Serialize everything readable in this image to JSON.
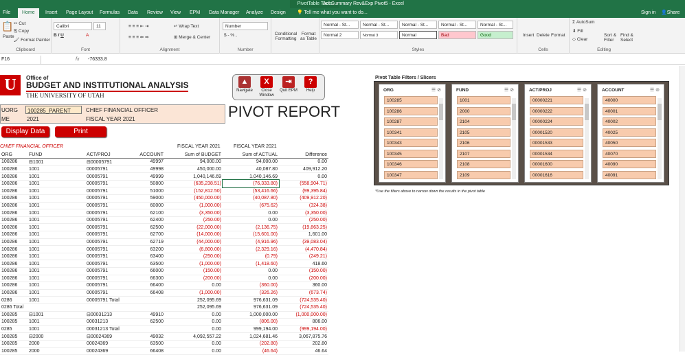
{
  "titlebar": {
    "context_tab": "PivotTable Tools",
    "title": "Act Summary Rev&Exp Pivot5 - Excel"
  },
  "tabs": [
    "File",
    "Home",
    "Insert",
    "Page Layout",
    "Formulas",
    "Data",
    "Review",
    "View",
    "EPM",
    "Data Manager",
    "Analyze",
    "Design"
  ],
  "tell_me": "Tell me what you want to do...",
  "signin": "Sign in",
  "share": "Share",
  "ribbon": {
    "cut": "Cut",
    "copy": "Copy",
    "format_painter": "Format Painter",
    "paste": "Paste",
    "clipboard": "Clipboard",
    "font_name": "Calibri",
    "font_size": "11",
    "font": "Font",
    "wrap": "Wrap Text",
    "merge": "Merge & Center",
    "alignment": "Alignment",
    "numfmt": "Number",
    "number": "Number",
    "cond": "Conditional Formatting",
    "fmt_table": "Format as Table",
    "styles": [
      "Normal - St...",
      "Normal - St...",
      "Normal - St...",
      "Normal - St...",
      "Normal - St...",
      "Normal 2",
      "Normal 3",
      "Normal",
      "Bad",
      "Good"
    ],
    "styles_label": "Styles",
    "insert": "Insert",
    "delete": "Delete",
    "format": "Format",
    "cells": "Cells",
    "autosum": "AutoSum",
    "fill": "Fill",
    "clear": "Clear",
    "sort": "Sort & Filter",
    "find": "Find & Select",
    "editing": "Editing"
  },
  "formula": {
    "name": "F16",
    "fx": "fx",
    "value": "-76333.8"
  },
  "header": {
    "office": "Office of",
    "budget": "BUDGET AND INSTITUTIONAL ANALYSIS",
    "uu": "THE UNIVERSITY OF UTAH",
    "logo": "U",
    "org_label": "UORG",
    "org_value": "100285_PARENT",
    "cfo": "CHIEF FINANCIAL OFFICER",
    "me_label": "ME",
    "year": "2021",
    "fy": "FISCAL YEAR 2021",
    "pivot_title": "PIVOT REPORT",
    "display": "Display Data",
    "print": "Print"
  },
  "nav": [
    {
      "label": "Navigate",
      "g": "▲"
    },
    {
      "label": "Close Window",
      "g": "X"
    },
    {
      "label": "Quit EPM",
      "g": "⇥"
    },
    {
      "label": "Help",
      "g": "?"
    }
  ],
  "pivot": {
    "cfo": "CHIEF FINANCIAL OFFICER",
    "fy1": "FISCAL YEAR 2021",
    "fy2": "FISCAL YEAR 2021",
    "cols": [
      "ORG",
      "FUND",
      "ACT/PROJ",
      "ACCOUNT",
      "Sum of BUDGET",
      "Sum of ACTUAL",
      "Difference"
    ],
    "rows": [
      [
        "100286",
        "⊟1001",
        "⊟00005791",
        "49997",
        "94,000.00",
        "94,000.00",
        "0.00"
      ],
      [
        "100286",
        "1001",
        "00005791",
        "49998",
        "450,000.00",
        "40,087.80",
        "409,912.20"
      ],
      [
        "100286",
        "1001",
        "00005791",
        "49999",
        "1,040,146.69",
        "1,040,146.69",
        "0.00"
      ],
      [
        "100286",
        "1001",
        "00005791",
        "50800",
        "(635,238.51)",
        "(76,333.80)",
        "(558,904.71)"
      ],
      [
        "100286",
        "1001",
        "00005791",
        "51000",
        "(152,812.50)",
        "(53,416.66)",
        "(99,395.84)"
      ],
      [
        "100286",
        "1001",
        "00005791",
        "59000",
        "(450,000.00)",
        "(40,087.80)",
        "(409,912.20)"
      ],
      [
        "100286",
        "1001",
        "00005791",
        "60000",
        "(1,000.00)",
        "(675.62)",
        "(324.38)"
      ],
      [
        "100286",
        "1001",
        "00005791",
        "62100",
        "(3,350.00)",
        "0.00",
        "(3,350.00)"
      ],
      [
        "100286",
        "1001",
        "00005791",
        "62400",
        "(250.00)",
        "0.00",
        "(250.00)"
      ],
      [
        "100286",
        "1001",
        "00005791",
        "62500",
        "(22,000.00)",
        "(2,136.75)",
        "(19,863.25)"
      ],
      [
        "100286",
        "1001",
        "00005791",
        "62700",
        "(14,000.00)",
        "(15,601.00)",
        "1,601.00"
      ],
      [
        "100286",
        "1001",
        "00005791",
        "62719",
        "(44,000.00)",
        "(4,916.96)",
        "(39,083.04)"
      ],
      [
        "100286",
        "1001",
        "00005791",
        "63200",
        "(6,800.00)",
        "(2,329.16)",
        "(4,470.84)"
      ],
      [
        "100286",
        "1001",
        "00005791",
        "63400",
        "(250.00)",
        "(0.79)",
        "(249.21)"
      ],
      [
        "100286",
        "1001",
        "00005791",
        "63500",
        "(1,000.00)",
        "(1,418.60)",
        "418.60"
      ],
      [
        "100286",
        "1001",
        "00005791",
        "66000",
        "(150.00)",
        "0.00",
        "(150.00)"
      ],
      [
        "100286",
        "1001",
        "00005791",
        "66300",
        "(200.00)",
        "0.00",
        "(200.00)"
      ],
      [
        "100286",
        "1001",
        "00005791",
        "66400",
        "0.00",
        "(360.00)",
        "360.00"
      ],
      [
        "100286",
        "1001",
        "00005791",
        "66408",
        "(1,000.00)",
        "(326.26)",
        "(673.74)"
      ],
      [
        "0286",
        "1001",
        "00005791 Total",
        "",
        "252,095.69",
        "976,631.09",
        "(724,535.40)"
      ],
      [
        "0286 Total",
        "",
        "",
        "",
        "252,095.69",
        "976,631.09",
        "(724,535.40)"
      ],
      [
        "100285",
        "⊟1001",
        "⊟00031213",
        "49910",
        "0.00",
        "1,000,000.00",
        "(1,000,000.00)"
      ],
      [
        "100285",
        "1001",
        "00031213",
        "62500",
        "0.00",
        "(806.00)",
        "806.00"
      ],
      [
        "0285",
        "1001",
        "00031213 Total",
        "",
        "0.00",
        "999,194.00",
        "(999,194.00)"
      ],
      [
        "100285",
        "⊟2000",
        "⊟00024369",
        "49032",
        "4,092,557.22",
        "1,024,681.46",
        "3,067,875.76"
      ],
      [
        "100285",
        "2000",
        "00024369",
        "63500",
        "0.00",
        "(202.80)",
        "202.80"
      ],
      [
        "100285",
        "2000",
        "00024369",
        "66408",
        "0.00",
        "(46.64)",
        "46.64"
      ]
    ]
  },
  "slicers": {
    "header": "Pivot Table Filters / Slicers",
    "note": "*Use the filters above to narrow down the results in the pivot table",
    "list": [
      {
        "title": "ORG",
        "items": [
          "100285",
          "100286",
          "100287",
          "100341",
          "100343",
          "100345",
          "100346",
          "100347"
        ]
      },
      {
        "title": "FUND",
        "items": [
          "1001",
          "2000",
          "2104",
          "2105",
          "2106",
          "2107",
          "2108",
          "2109"
        ]
      },
      {
        "title": "ACT/PROJ",
        "items": [
          "00000221",
          "00000222",
          "00000224",
          "00001520",
          "00001533",
          "00001534",
          "00001600",
          "00001616"
        ]
      },
      {
        "title": "ACCOUNT",
        "items": [
          "40000",
          "40001",
          "40002",
          "40025",
          "40050",
          "40070",
          "40090",
          "40091"
        ]
      }
    ]
  }
}
